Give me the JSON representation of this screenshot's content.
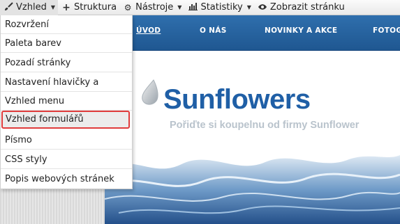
{
  "toolbar": {
    "items": [
      {
        "label": "Vzhled",
        "icon": "brush-icon",
        "has_caret": true
      },
      {
        "label": "Struktura",
        "icon": "plus-icon",
        "has_caret": false
      },
      {
        "label": "Nástroje",
        "icon": "gears-icon",
        "has_caret": true
      },
      {
        "label": "Statistiky",
        "icon": "bar-chart-icon",
        "has_caret": true
      },
      {
        "label": "Zobrazit stránku",
        "icon": "eye-icon",
        "has_caret": false
      }
    ]
  },
  "menu": {
    "items": [
      "Rozvržení",
      "Paleta barev",
      "Pozadí stránky",
      "Nastavení hlavičky a patičky",
      "Vzhled menu",
      "Vzhled formulářů",
      "Písmo",
      "CSS styly",
      "Popis webových stránek"
    ],
    "highlighted_index": 5,
    "highlight_color": "#e03c3c"
  },
  "site": {
    "nav": [
      "ÚVOD",
      "O NÁS",
      "NOVINKY A AKCE",
      "FOTOG"
    ],
    "logo": "Sunflowers",
    "tagline": "Pořiďte si koupelnu od firmy Sunflower",
    "brand_color": "#1f5fa6",
    "nav_color": "#2a65a3"
  }
}
